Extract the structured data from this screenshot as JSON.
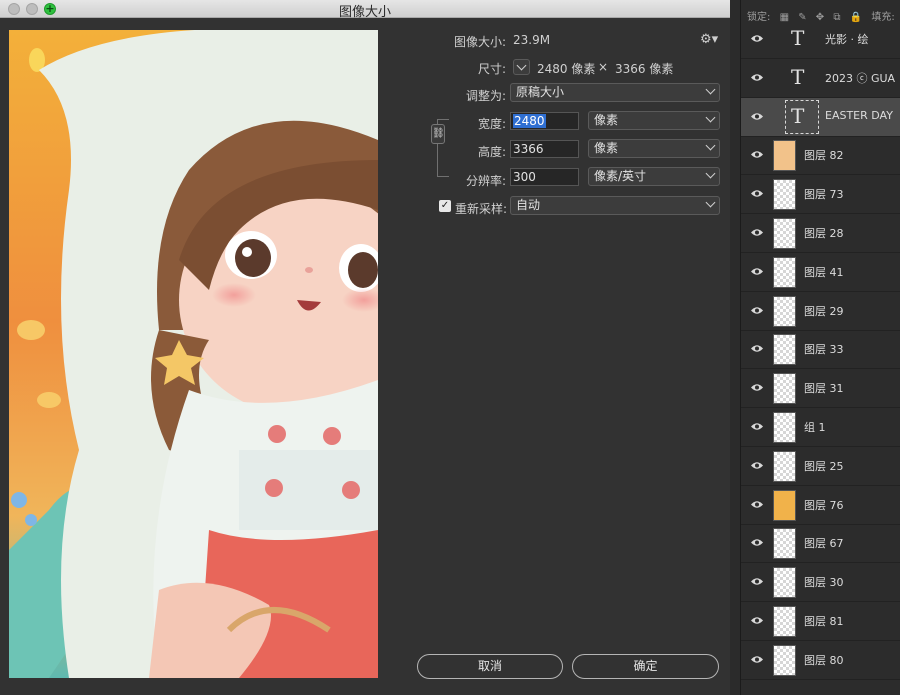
{
  "dialog": {
    "title": "图像大小",
    "image_size_label": "图像大小:",
    "image_size_value": "23.9M",
    "dimensions_label": "尺寸:",
    "dimensions_width": "2480 像素",
    "dimensions_separator": "×",
    "dimensions_height": "3366 像素",
    "fit_to_label": "调整为:",
    "fit_to_value": "原稿大小",
    "width_label": "宽度:",
    "width_value": "2480",
    "width_unit": "像素",
    "height_label": "高度:",
    "height_value": "3366",
    "height_unit": "像素",
    "resolution_label": "分辨率:",
    "resolution_value": "300",
    "resolution_unit": "像素/英寸",
    "resample_label": "重新采样:",
    "resample_value": "自动",
    "resample_checked": true,
    "cancel_label": "取消",
    "ok_label": "确定"
  },
  "layers_panel": {
    "lock_label": "锁定:",
    "fill_label": "填充:",
    "layers": [
      {
        "type": "text",
        "name": "光影 · 绘"
      },
      {
        "type": "text",
        "name": "2023 ⓒ GUA"
      },
      {
        "type": "text",
        "name": "EASTER DAY",
        "active": true
      },
      {
        "type": "pixel",
        "name": "图层 82",
        "thumb": "#f2c28a"
      },
      {
        "type": "pixel",
        "name": "图层 73"
      },
      {
        "type": "pixel",
        "name": "图层 28"
      },
      {
        "type": "pixel",
        "name": "图层 41"
      },
      {
        "type": "pixel",
        "name": "图层 29"
      },
      {
        "type": "pixel",
        "name": "图层 33"
      },
      {
        "type": "pixel",
        "name": "图层 31"
      },
      {
        "type": "pixel",
        "name": "组 1"
      },
      {
        "type": "pixel",
        "name": "图层 25"
      },
      {
        "type": "pixel",
        "name": "图层 76",
        "thumb": "#f1b24a"
      },
      {
        "type": "pixel",
        "name": "图层 67"
      },
      {
        "type": "pixel",
        "name": "图层 30"
      },
      {
        "type": "pixel",
        "name": "图层 81"
      },
      {
        "type": "pixel",
        "name": "图层 80"
      }
    ]
  }
}
